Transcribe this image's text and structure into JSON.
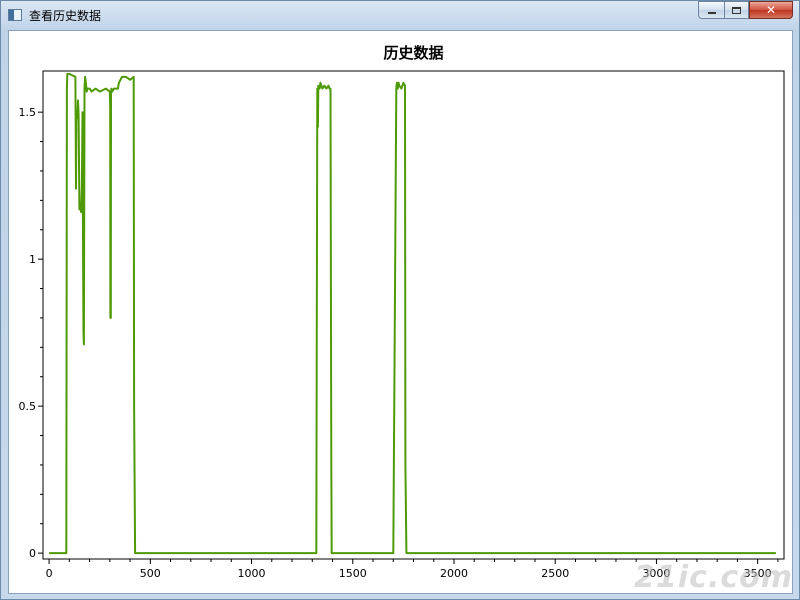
{
  "window": {
    "title": "查看历史数据",
    "minimize_glyph": "",
    "maximize_glyph": "",
    "close_glyph": "✕"
  },
  "watermark": {
    "text": "21ic.com"
  },
  "chart_data": {
    "type": "line",
    "title": "历史数据",
    "xlabel": "",
    "ylabel": "",
    "xlim": [
      -30,
      3630
    ],
    "ylim": [
      -0.02,
      1.64
    ],
    "grid": false,
    "legend": "none",
    "x_ticks": [
      0,
      500,
      1000,
      1500,
      2000,
      2500,
      3000,
      3500
    ],
    "x_tick_labels": [
      "0",
      "500",
      "1000",
      "1500",
      "2000",
      "2500",
      "3000",
      "3500"
    ],
    "y_ticks": [
      0,
      0.5,
      1,
      1.5
    ],
    "y_tick_labels": [
      "0",
      "0.5",
      "1",
      "1.5"
    ],
    "series": [
      {
        "color": "#4e9a06",
        "x": [
          0,
          85,
          88,
          90,
          100,
          130,
          133,
          135,
          140,
          143,
          146,
          150,
          155,
          158,
          162,
          165,
          168,
          170,
          172,
          175,
          178,
          182,
          186,
          190,
          195,
          200,
          210,
          230,
          250,
          280,
          300,
          302,
          303,
          305,
          306,
          308,
          312,
          320,
          330,
          340,
          345,
          360,
          380,
          400,
          418,
          420,
          425,
          1320,
          1325,
          1328,
          1330,
          1333,
          1336,
          1340,
          1350,
          1360,
          1370,
          1380,
          1385,
          1390,
          1394,
          1396,
          1400,
          1700,
          1715,
          1718,
          1722,
          1726,
          1730,
          1740,
          1750,
          1758,
          1760,
          1765,
          3590
        ],
        "y": [
          0,
          0,
          1.58,
          1.63,
          1.63,
          1.62,
          1.24,
          1.5,
          1.48,
          1.54,
          1.49,
          1.17,
          1.17,
          1.16,
          1.25,
          1.5,
          1.0,
          0.75,
          0.71,
          1.58,
          1.62,
          1.6,
          1.57,
          1.58,
          1.58,
          1.58,
          1.57,
          1.58,
          1.57,
          1.58,
          1.57,
          1.52,
          0.8,
          0.8,
          1.56,
          1.58,
          1.57,
          1.58,
          1.58,
          1.58,
          1.6,
          1.62,
          1.62,
          1.61,
          1.62,
          0.5,
          0,
          0,
          1.58,
          1.45,
          1.59,
          1.58,
          1.58,
          1.6,
          1.58,
          1.59,
          1.58,
          1.59,
          1.58,
          1.58,
          0.3,
          0,
          0,
          0,
          1.58,
          1.6,
          1.58,
          1.6,
          1.59,
          1.58,
          1.6,
          1.59,
          0.3,
          0,
          0
        ]
      }
    ]
  }
}
